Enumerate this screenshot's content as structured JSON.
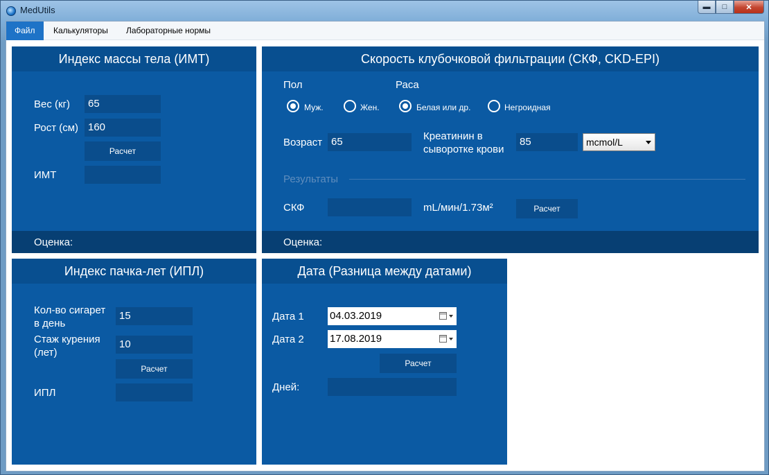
{
  "window": {
    "title": "MedUtils",
    "controls": {
      "minimize": "▬",
      "maximize": "□",
      "close": "✕"
    }
  },
  "menu": {
    "items": [
      "Файл",
      "Калькуляторы",
      "Лабораторные нормы"
    ]
  },
  "bmi": {
    "title": "Индекс массы тела (ИМТ)",
    "weight_label": "Вес (кг)",
    "weight_value": "65",
    "height_label": "Рост (см)",
    "height_value": "160",
    "calc_button": "Расчет",
    "result_label": "ИМТ",
    "result_value": "",
    "assessment_label": "Оценка:"
  },
  "gfr": {
    "title": "Скорость клубочковой фильтрации (СКФ, CKD-EPI)",
    "sex_label": "Пол",
    "race_label": "Раса",
    "sex_options": [
      {
        "label": "Муж.",
        "checked": true
      },
      {
        "label": "Жен.",
        "checked": false
      }
    ],
    "race_options": [
      {
        "label": "Белая или др.",
        "checked": true
      },
      {
        "label": "Негроидная",
        "checked": false
      }
    ],
    "age_label": "Возраст",
    "age_value": "65",
    "creatinine_label_line1": "Креатинин в",
    "creatinine_label_line2": "сыворотке крови",
    "creatinine_value": "85",
    "unit_selected": "mcmol/L",
    "results_label": "Результаты",
    "gfr_label": "СКФ",
    "gfr_value": "",
    "gfr_unit": "mL/мин/1.73м²",
    "calc_button": "Расчет",
    "assessment_label": "Оценка:"
  },
  "packyears": {
    "title": "Индекс пачка-лет (ИПЛ)",
    "cigs_label_line1": "Кол-во сигарет",
    "cigs_label_line2": "в день",
    "cigs_value": "15",
    "years_label_line1": "Стаж курения",
    "years_label_line2": "(лет)",
    "years_value": "10",
    "calc_button": "Расчет",
    "result_label": "ИПЛ",
    "result_value": ""
  },
  "dates": {
    "title": "Дата (Разница между датами)",
    "date1_label": "Дата 1",
    "date1_value": "04.03.2019",
    "date2_label": "Дата 2",
    "date2_value": "17.08.2019",
    "calc_button": "Расчет",
    "days_label": "Дней:",
    "days_value": ""
  },
  "colors": {
    "panel_bg": "#0b5aa3",
    "panel_header": "#084f90",
    "field_bg": "#0a4d8c",
    "menu_active": "#1e73c7"
  }
}
